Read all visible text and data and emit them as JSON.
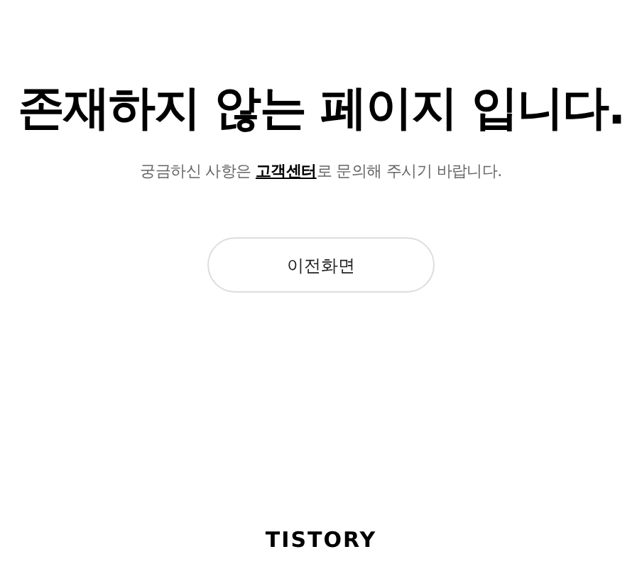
{
  "title": "존재하지 않는 페이지 입니다.",
  "message": {
    "before": "궁금하신 사항은 ",
    "link": "고객센터",
    "after": "로 문의해 주시기 바랍니다."
  },
  "back_button": "이전화면",
  "footer_logo": "TISTORY"
}
